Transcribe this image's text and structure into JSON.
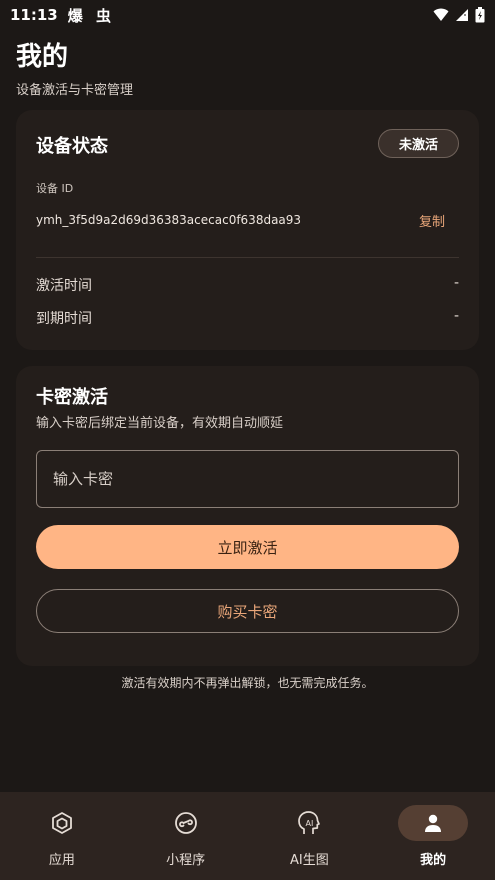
{
  "status_bar": {
    "time": "11:13",
    "notifications": "爆 虫"
  },
  "header": {
    "title": "我的",
    "subtitle": "设备激活与卡密管理"
  },
  "device_status": {
    "title": "设备状态",
    "badge": "未激活",
    "id_label": "设备 ID",
    "id_value": "ymh_3f5d9a2d69d36383acecac0f638daa93",
    "copy_label": "复制",
    "rows": [
      {
        "label": "激活时间",
        "value": "-"
      },
      {
        "label": "到期时间",
        "value": "-"
      }
    ]
  },
  "activation": {
    "title": "卡密激活",
    "description": "输入卡密后绑定当前设备，有效期自动顺延",
    "input_placeholder": "输入卡密",
    "input_value": "",
    "activate_button": "立即激活",
    "buy_button": "购买卡密",
    "note": "激活有效期内不再弹出解锁，也无需完成任务。"
  },
  "colors": {
    "background": "#1c1816",
    "card": "#241e1b",
    "accent": "#ffb585",
    "accent_text": "#e9a679",
    "nav_background": "#2d2420",
    "nav_active_pill": "#553f33"
  },
  "bottom_nav": {
    "items": [
      {
        "label": "应用",
        "icon": "apps-cube-icon",
        "active": false
      },
      {
        "label": "小程序",
        "icon": "mini-program-icon",
        "active": false
      },
      {
        "label": "AI生图",
        "icon": "ai-head-icon",
        "active": false
      },
      {
        "label": "我的",
        "icon": "person-icon",
        "active": true
      }
    ]
  }
}
